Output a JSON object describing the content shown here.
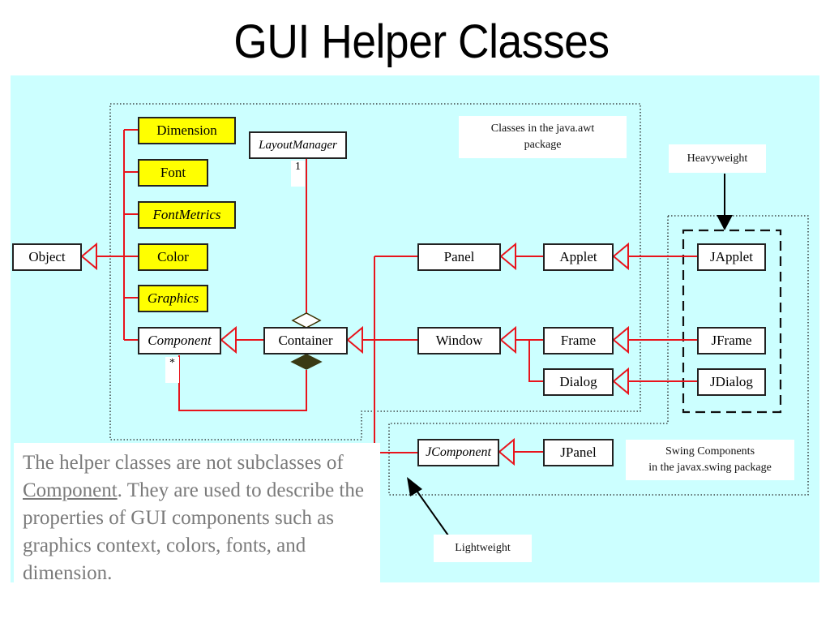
{
  "title": "GUI Helper Classes",
  "classes": {
    "object": "Object",
    "dimension": "Dimension",
    "font": "Font",
    "fontmetrics": "FontMetrics",
    "color": "Color",
    "graphics": "Graphics",
    "component": "Component",
    "container": "Container",
    "layoutmanager": "LayoutManager",
    "panel": "Panel",
    "applet": "Applet",
    "window": "Window",
    "frame": "Frame",
    "dialog": "Dialog",
    "japplet": "JApplet",
    "jframe": "JFrame",
    "jdialog": "JDialog",
    "jcomponent": "JComponent",
    "jpanel": "JPanel"
  },
  "multiplicity": {
    "layout_one": "1",
    "component_many": "*"
  },
  "labels": {
    "awt_package_line1": "Classes in the java.awt",
    "awt_package_line2": "package",
    "heavyweight": "Heavyweight",
    "lightweight": "Lightweight",
    "swing_line1": "Swing Components",
    "swing_line2": "in the javax.swing package"
  },
  "note": {
    "part1": "The helper classes are not subclasses of ",
    "link": "Component",
    "part2": ". They are used to describe the properties of GUI components such as graphics context, colors, fonts, and dimension."
  },
  "colors": {
    "background": "#ccffff",
    "helper_fill": "#ffff00",
    "inheritance_line": "#e8141c"
  }
}
